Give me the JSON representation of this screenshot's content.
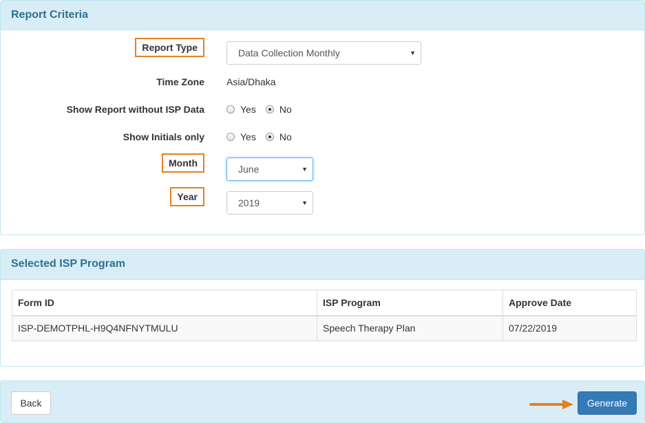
{
  "criteria": {
    "heading": "Report Criteria",
    "report_type_label": "Report Type",
    "report_type_value": "Data Collection Monthly",
    "time_zone_label": "Time Zone",
    "time_zone_value": "Asia/Dhaka",
    "show_without_isp_label": "Show Report without ISP Data",
    "show_initials_label": "Show Initials only",
    "yes_label": "Yes",
    "no_label": "No",
    "show_without_isp_selected": "No",
    "show_initials_selected": "No",
    "month_label": "Month",
    "month_value": "June",
    "year_label": "Year",
    "year_value": "2019"
  },
  "isp": {
    "heading": "Selected ISP Program",
    "columns": [
      "Form ID",
      "ISP Program",
      "Approve Date"
    ],
    "rows": [
      [
        "ISP-DEMOTPHL-H9Q4NFNYTMULU",
        "Speech Therapy Plan",
        "07/22/2019"
      ]
    ]
  },
  "footer": {
    "back_label": "Back",
    "generate_label": "Generate"
  },
  "colors": {
    "highlight": "#e67e22",
    "primary": "#337ab7",
    "panel_heading_bg": "#d9edf7"
  }
}
